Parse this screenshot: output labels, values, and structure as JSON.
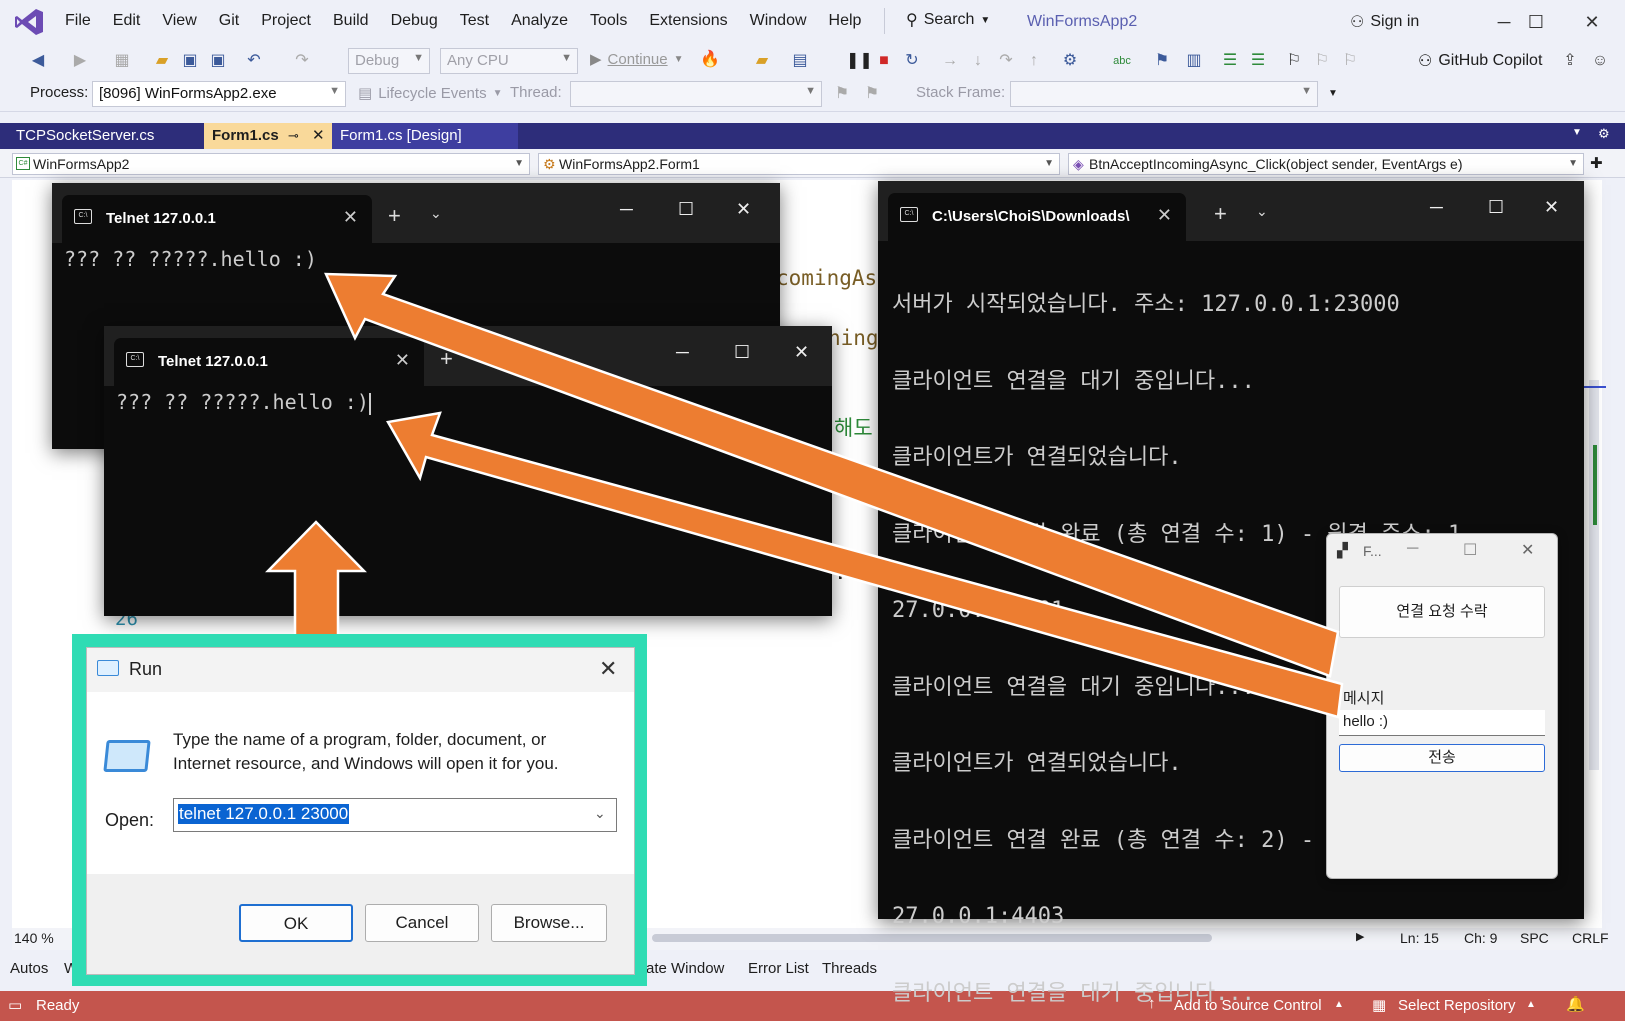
{
  "vs": {
    "menu": [
      "File",
      "Edit",
      "View",
      "Git",
      "Project",
      "Build",
      "Debug",
      "Test",
      "Analyze",
      "Tools",
      "Extensions",
      "Window",
      "Help"
    ],
    "search_label": "Search",
    "app_title": "WinFormsApp2",
    "sign_in": "Sign in",
    "toolbar": {
      "config": "Debug",
      "platform": "Any CPU",
      "continue": "Continue",
      "copilot": "GitHub Copilot",
      "process_label": "Process:",
      "process_value": "[8096] WinFormsApp2.exe",
      "lifecycle": "Lifecycle Events",
      "thread_label": "Thread:",
      "stack_label": "Stack Frame:"
    },
    "tabs": [
      {
        "label": "TCPSocketServer.cs"
      },
      {
        "label": "Form1.cs"
      },
      {
        "label": "Form1.cs [Design]"
      }
    ],
    "nav": {
      "project": "WinFormsApp2",
      "class": "WinFormsApp2.Form1",
      "member": "BtnAcceptIncomingAsync_Click(object sender, EventArgs e)"
    },
    "code_fragments": {
      "f1": "comingAs",
      "f2": "ning",
      "f3": "해도",
      "f4": ".Te",
      "brace": "}",
      "line_no": "26"
    },
    "editor_status": {
      "zoom": "140 %",
      "ln": "Ln: 15",
      "ch": "Ch: 9",
      "spc": "SPC",
      "eol": "CRLF"
    },
    "bottom_tabs": [
      "Autos",
      "W",
      "ate Window",
      "Error List",
      "Threads"
    ],
    "statusbar": {
      "ready": "Ready",
      "add_source": "Add to Source Control",
      "select_repo": "Select Repository"
    }
  },
  "telnet1": {
    "tab_title": "Telnet 127.0.0.1",
    "output": "??? ?? ?????.hello :)"
  },
  "telnet2": {
    "tab_title": "Telnet 127.0.0.1",
    "output": "??? ?? ?????.hello :)"
  },
  "server": {
    "tab_title": "C:\\Users\\ChoiS\\Downloads\\",
    "lines": [
      "서버가 시작되었습니다. 주소: 127.0.0.1:23000",
      "클라이언트 연결을 대기 중입니다...",
      "클라이언트가 연결되었습니다.",
      "클라이언트 연결 완료 (총 연결 수: 1) - 원격 주소: 1",
      "27.0.0.1:4401",
      "클라이언트 연결을 대기 중입니다...",
      "클라이언트가 연결되었습니다.",
      "클라이언트 연결 완료 (총 연결 수: 2) - 원격 주소: 1",
      "27.0.0.1:4403",
      "클라이언트 연결을 대기 중입니다..."
    ]
  },
  "form": {
    "title": "F...",
    "accept_button": "연결 요청 수락",
    "message_label": "메시지",
    "message_value": "hello :)",
    "send_button": "전송"
  },
  "run": {
    "title": "Run",
    "description_line1": "Type the name of a program, folder, document, or",
    "description_line2": "Internet resource, and Windows will open it for you.",
    "open_label": "Open:",
    "open_value": "telnet 127.0.0.1 23000",
    "ok": "OK",
    "cancel": "Cancel",
    "browse": "Browse..."
  },
  "colors": {
    "status_bar": "#c4554d",
    "run_highlight": "#2fdcb4",
    "arrow": "#ed7d31",
    "tab_strip": "#2d2d7a"
  }
}
